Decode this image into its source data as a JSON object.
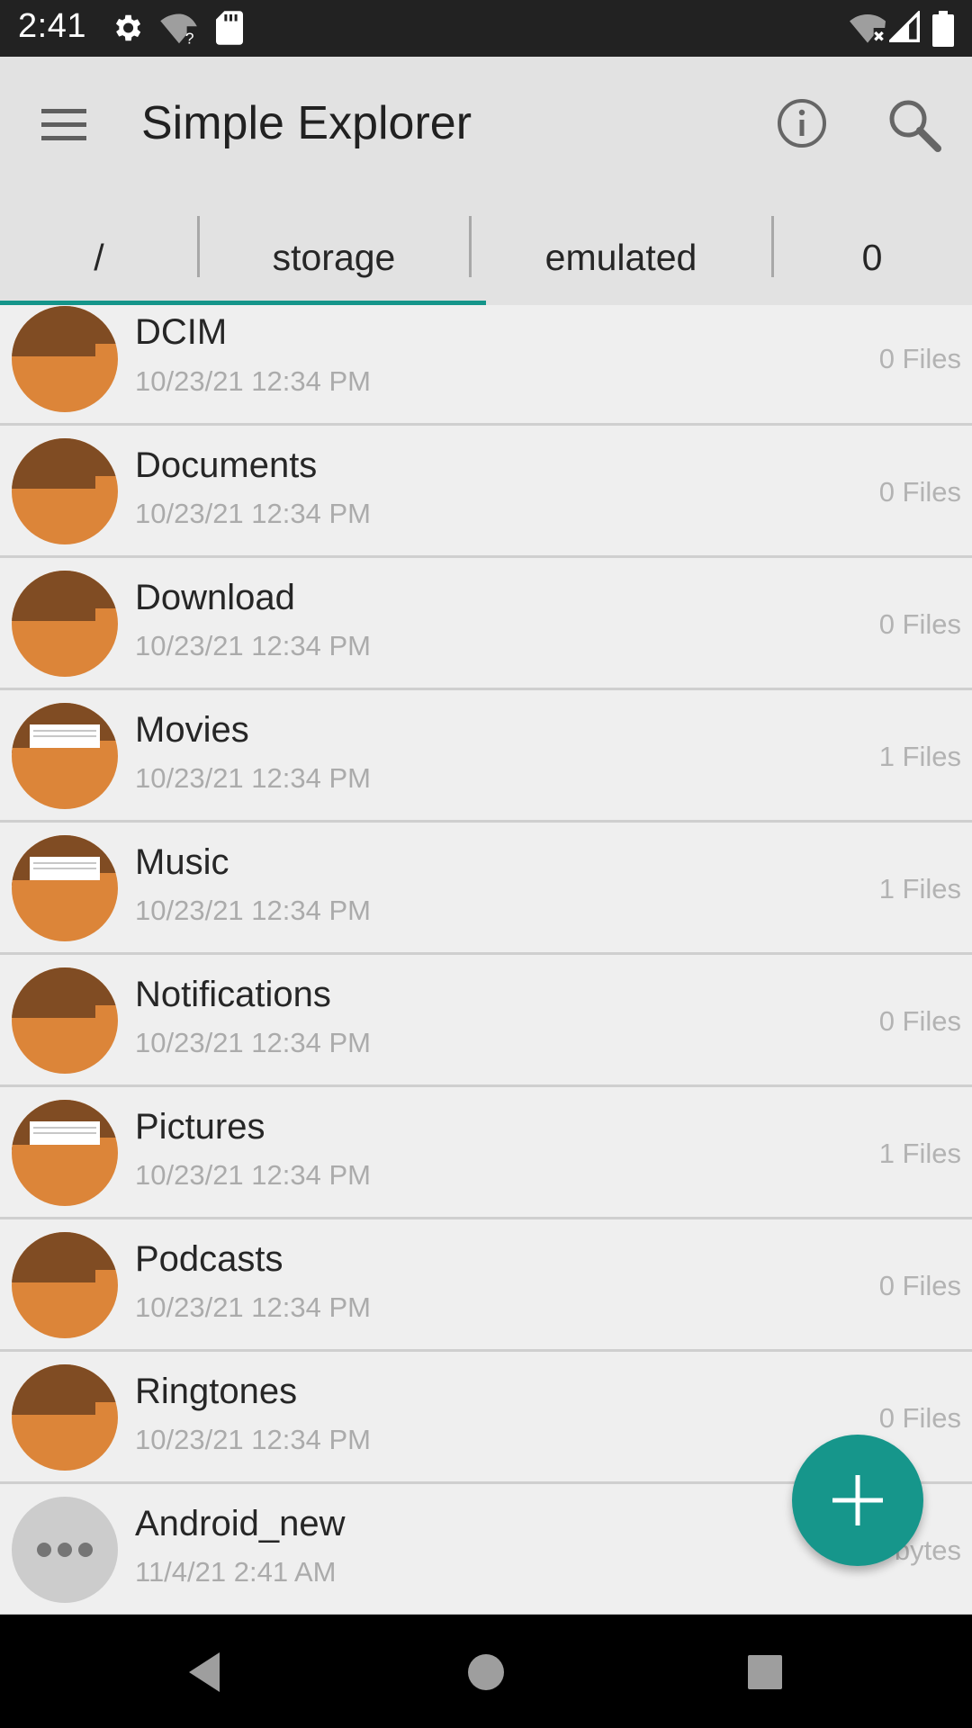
{
  "status_bar": {
    "time": "2:41",
    "icons": [
      "settings-icon",
      "wifi-unknown-icon",
      "sd-card-icon",
      "wifi-off-icon",
      "signal-icon",
      "battery-icon"
    ]
  },
  "app_bar": {
    "title": "Simple Explorer",
    "menu_icon": "hamburger-menu-icon",
    "actions": [
      "info-icon",
      "search-icon"
    ]
  },
  "breadcrumbs": [
    {
      "label": "/"
    },
    {
      "label": "storage"
    },
    {
      "label": "emulated"
    },
    {
      "label": "0"
    }
  ],
  "files": [
    {
      "name": "DCIM",
      "date": "10/23/21 12:34 PM",
      "count": "0 Files",
      "icon": "folder-icon"
    },
    {
      "name": "Documents",
      "date": "10/23/21 12:34 PM",
      "count": "0 Files",
      "icon": "folder-icon"
    },
    {
      "name": "Download",
      "date": "10/23/21 12:34 PM",
      "count": "0 Files",
      "icon": "folder-icon"
    },
    {
      "name": "Movies",
      "date": "10/23/21 12:34 PM",
      "count": "1 Files",
      "icon": "folder-with-files-icon"
    },
    {
      "name": "Music",
      "date": "10/23/21 12:34 PM",
      "count": "1 Files",
      "icon": "folder-with-files-icon"
    },
    {
      "name": "Notifications",
      "date": "10/23/21 12:34 PM",
      "count": "0 Files",
      "icon": "folder-icon"
    },
    {
      "name": "Pictures",
      "date": "10/23/21 12:34 PM",
      "count": "1 Files",
      "icon": "folder-with-files-icon"
    },
    {
      "name": "Podcasts",
      "date": "10/23/21 12:34 PM",
      "count": "0 Files",
      "icon": "folder-icon"
    },
    {
      "name": "Ringtones",
      "date": "10/23/21 12:34 PM",
      "count": "0 Files",
      "icon": "folder-icon"
    },
    {
      "name": "Android_new",
      "date": "11/4/21 2:41 AM",
      "count": "bytes",
      "icon": "unknown-file-icon"
    }
  ],
  "fab": {
    "icon": "add-icon"
  },
  "nav_bar": {
    "buttons": [
      "back-icon",
      "home-icon",
      "recents-icon"
    ]
  },
  "colors": {
    "accent": "#16968b",
    "folder_light": "#dc8539",
    "folder_dark": "#804c23",
    "app_bar": "#e2e2e2",
    "status_bar": "#222222"
  }
}
